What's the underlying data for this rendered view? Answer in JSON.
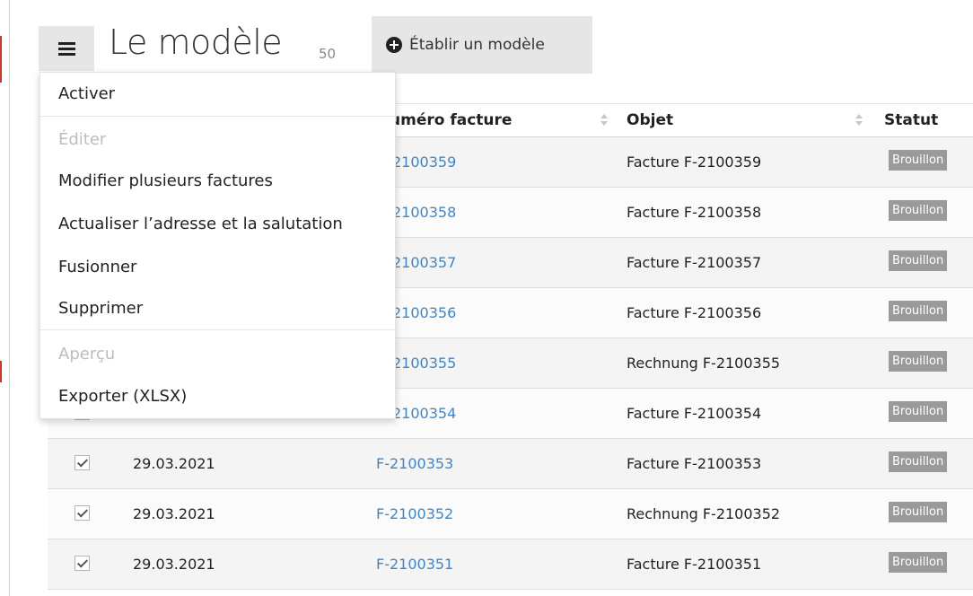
{
  "header": {
    "title": "Le modèle",
    "count": "50",
    "create_button": "Établir un modèle"
  },
  "table": {
    "columns": {
      "number": "uméro facture",
      "subject": "Objet",
      "status": "Statut"
    },
    "rows": [
      {
        "date": "",
        "number": "2100359",
        "subject": "Facture F-2100359",
        "status": "Brouillon"
      },
      {
        "date": "",
        "number": "2100358",
        "subject": "Facture F-2100358",
        "status": "Brouillon"
      },
      {
        "date": "",
        "number": "2100357",
        "subject": "Facture F-2100357",
        "status": "Brouillon"
      },
      {
        "date": "",
        "number": "2100356",
        "subject": "Facture F-2100356",
        "status": "Brouillon"
      },
      {
        "date": "",
        "number": "2100355",
        "subject": "Rechnung F-2100355",
        "status": "Brouillon"
      },
      {
        "date": "",
        "number": "2100354",
        "subject": "Facture F-2100354",
        "status": "Brouillon"
      },
      {
        "date": "29.03.2021",
        "number": "F-2100353",
        "subject": "Facture F-2100353",
        "status": "Brouillon"
      },
      {
        "date": "29.03.2021",
        "number": "F-2100352",
        "subject": "Rechnung F-2100352",
        "status": "Brouillon"
      },
      {
        "date": "29.03.2021",
        "number": "F-2100351",
        "subject": "Facture F-2100351",
        "status": "Brouillon"
      }
    ]
  },
  "dropdown": {
    "items": [
      {
        "label": "Activer",
        "disabled": false
      },
      {
        "label": "Éditer",
        "disabled": true
      },
      {
        "label": "Modifier plusieurs factures",
        "disabled": false
      },
      {
        "label": "Actualiser l’adresse et la salutation",
        "disabled": false
      },
      {
        "label": "Fusionner",
        "disabled": false
      },
      {
        "label": "Supprimer",
        "disabled": false
      },
      {
        "label": "Aperçu",
        "disabled": true
      },
      {
        "label": "Exporter (XLSX)",
        "disabled": false,
        "highlighted": true
      }
    ]
  },
  "colors": {
    "link": "#3f86c6",
    "badge": "#9a9a9a",
    "highlight": "#f7f500",
    "button_bg": "#e6e6e6"
  }
}
